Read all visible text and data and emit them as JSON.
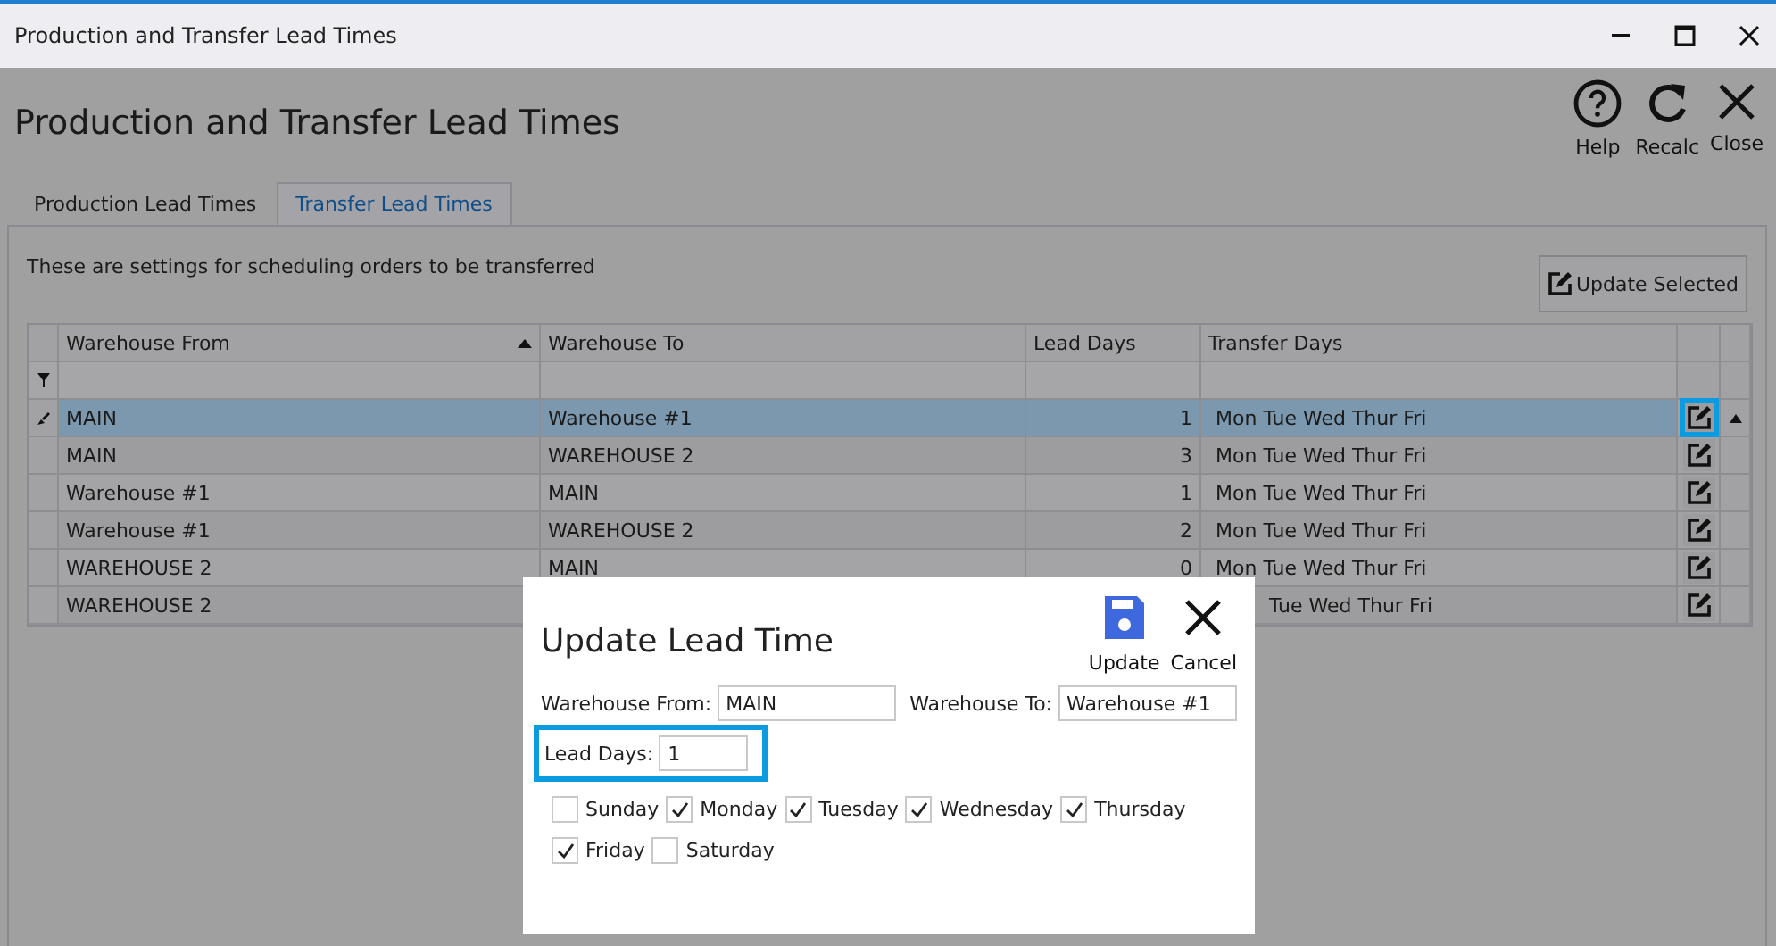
{
  "window": {
    "title": "Production and Transfer Lead Times"
  },
  "heading": "Production and Transfer Lead Times",
  "toolbar": [
    {
      "kind": "help",
      "label": "Help"
    },
    {
      "kind": "recalc",
      "label": "Recalc"
    },
    {
      "kind": "close",
      "label": "Close"
    }
  ],
  "tabs": [
    {
      "label": "Production Lead Times",
      "selected": false
    },
    {
      "label": "Transfer Lead Times",
      "selected": true
    }
  ],
  "description": "These are settings for scheduling orders to be transferred",
  "update_selected": "Update Selected",
  "table": {
    "columns": [
      "Warehouse From",
      "Warehouse To",
      "Lead Days",
      "Transfer Days"
    ],
    "rows": [
      {
        "from": "MAIN",
        "to": "Warehouse #1",
        "lead_days": "1",
        "transfer_days": "Mon Tue Wed Thur Fri",
        "selected": true,
        "highlighted": true
      },
      {
        "from": "MAIN",
        "to": "WAREHOUSE 2",
        "lead_days": "3",
        "transfer_days": "Mon Tue Wed Thur Fri",
        "selected": false,
        "highlighted": false
      },
      {
        "from": "Warehouse #1",
        "to": "MAIN",
        "lead_days": "1",
        "transfer_days": "Mon Tue Wed Thur Fri",
        "selected": false,
        "highlighted": false
      },
      {
        "from": "Warehouse #1",
        "to": "WAREHOUSE 2",
        "lead_days": "2",
        "transfer_days": "Mon Tue Wed Thur Fri",
        "selected": false,
        "highlighted": false
      },
      {
        "from": "WAREHOUSE 2",
        "to": "MAIN",
        "lead_days": "0",
        "transfer_days": "Mon Tue Wed Thur Fri",
        "selected": false,
        "highlighted": false
      },
      {
        "from": "WAREHOUSE 2",
        "transfer_days": "Tue Wed Thur Fri",
        "selected": false,
        "highlighted": false,
        "partly_covered": true
      }
    ]
  },
  "dialog": {
    "title": "Update Lead Time",
    "actions": [
      {
        "kind": "save",
        "label": "Update"
      },
      {
        "kind": "cancel",
        "label": "Cancel"
      }
    ],
    "from_label": "Warehouse From:",
    "from_value": "MAIN",
    "to_label": "Warehouse To:",
    "to_value": "Warehouse #1",
    "lead_label": "Lead Days:",
    "lead_value": "1",
    "lead_highlighted": true,
    "days": [
      {
        "label": "Sunday",
        "checked": false
      },
      {
        "label": "Monday",
        "checked": true
      },
      {
        "label": "Tuesday",
        "checked": true
      },
      {
        "label": "Wednesday",
        "checked": true
      },
      {
        "label": "Thursday",
        "checked": true
      },
      {
        "label": "Friday",
        "checked": true
      },
      {
        "label": "Saturday",
        "checked": false
      }
    ]
  }
}
